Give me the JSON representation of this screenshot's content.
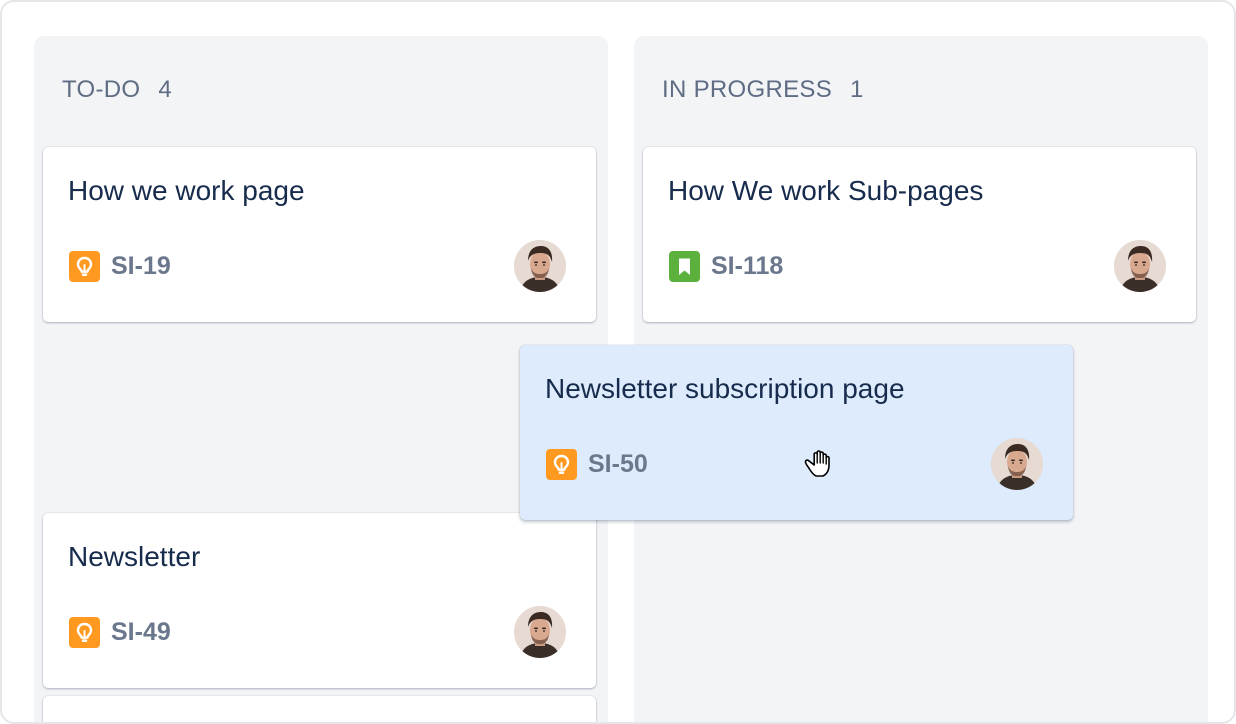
{
  "columns": [
    {
      "title": "TO-DO",
      "count": "4",
      "cards": [
        {
          "title": "How we work page",
          "key": "SI-19",
          "type_icon": "lightbulb-icon",
          "type_color": "#ff991f"
        },
        {
          "title": "Newsletter",
          "key": "SI-49",
          "type_icon": "lightbulb-icon",
          "type_color": "#ff991f"
        }
      ]
    },
    {
      "title": "IN PROGRESS",
      "count": "1",
      "cards": [
        {
          "title": "How We work Sub-pages",
          "key": "SI-118",
          "type_icon": "bookmark-icon",
          "type_color": "#5bb13c"
        }
      ]
    }
  ],
  "dragging_card": {
    "title": "Newsletter subscription page",
    "key": "SI-50",
    "type_icon": "lightbulb-icon",
    "type_color": "#ff991f",
    "background": "#deebfd"
  },
  "cursor": "grab-hand-icon"
}
